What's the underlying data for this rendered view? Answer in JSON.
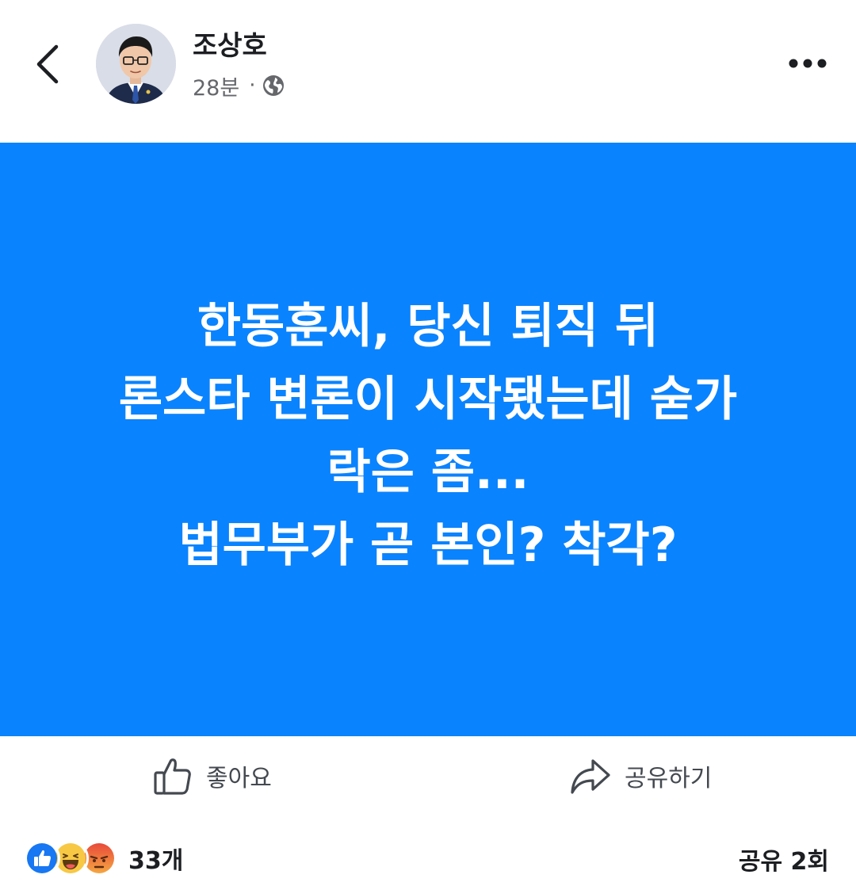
{
  "header": {
    "author_name": "조상호",
    "time_ago": "28분",
    "separator": "·",
    "privacy_icon": "globe-icon",
    "back_icon": "chevron-left-icon",
    "more_icon": "more-horizontal-icon"
  },
  "post": {
    "background_color": "#0a83fe",
    "text_color": "#ffffff",
    "lines": [
      "한동훈씨, 당신 퇴직 뒤",
      "론스타 변론이 시작됐는데 숟가",
      "락은 좀...",
      "법무부가 곧 본인? 착각?"
    ]
  },
  "actions": {
    "like_label": "좋아요",
    "like_icon": "thumbs-up-icon",
    "share_label": "공유하기",
    "share_icon": "share-arrow-icon"
  },
  "summary": {
    "reactions": [
      "like-reaction-icon",
      "haha-reaction-icon",
      "angry-reaction-icon"
    ],
    "reaction_count": "33개",
    "share_count": "공유 2회"
  },
  "colors": {
    "like_blue": "#1877f2",
    "haha_yellow": "#f7c844",
    "angry_orange": "#f0743a",
    "secondary_text": "#65676b"
  }
}
